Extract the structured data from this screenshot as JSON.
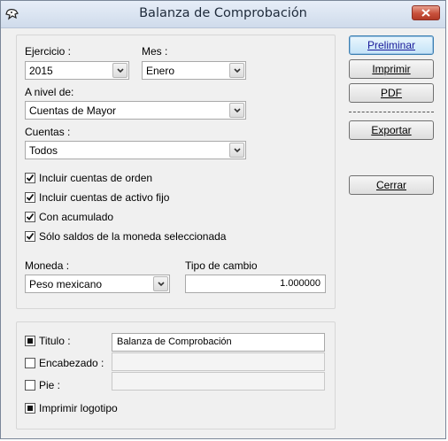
{
  "window": {
    "title": "Balanza de Comprobación"
  },
  "form": {
    "ejercicio": {
      "label": "Ejercicio :",
      "value": "2015"
    },
    "mes": {
      "label": "Mes :",
      "value": "Enero"
    },
    "nivel": {
      "label": "A nivel de:",
      "value": "Cuentas de Mayor"
    },
    "cuentas": {
      "label": "Cuentas :",
      "value": "Todos"
    },
    "checks": [
      {
        "label": "Incluir cuentas de orden",
        "checked": true
      },
      {
        "label": "Incluir cuentas de activo fijo",
        "checked": true
      },
      {
        "label": "Con acumulado",
        "checked": true
      },
      {
        "label": "Sólo saldos de la moneda seleccionada",
        "checked": true
      }
    ],
    "moneda": {
      "label": "Moneda :",
      "value": "Peso mexicano"
    },
    "tipo_cambio": {
      "label": "Tipo de cambio",
      "value": "1.000000"
    }
  },
  "options": {
    "titulo": {
      "label": "Titulo :",
      "value": "Balanza de Comprobación",
      "state": "indeterminate"
    },
    "encabezado": {
      "label": "Encabezado :",
      "value": "",
      "state": "unchecked"
    },
    "pie": {
      "label": "Pie :",
      "value": "",
      "state": "unchecked"
    },
    "logotipo": {
      "label": "Imprimir logotipo",
      "state": "indeterminate"
    }
  },
  "buttons": {
    "preliminar": "Preliminar",
    "imprimir": "Imprimir",
    "pdf": "PDF",
    "exportar": "Exportar",
    "cerrar": "Cerrar"
  },
  "colors": {
    "titlebar": "#dce6f3",
    "close": "#c8513c",
    "face": "#f0f0f0",
    "default_button": "#c4e3f7"
  }
}
